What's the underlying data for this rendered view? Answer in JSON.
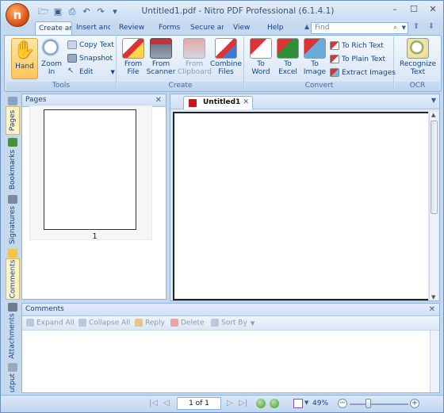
{
  "window": {
    "title": "Untitled1.pdf - Nitro PDF Professional (6.1.4.1)",
    "orb_letter": "n"
  },
  "tabs": [
    "Create and",
    "Insert and",
    "Review",
    "Forms",
    "Secure and",
    "View",
    "Help"
  ],
  "find": {
    "placeholder": "Find"
  },
  "ribbon": {
    "tools": {
      "label": "Tools",
      "hand": "Hand",
      "zoom_in": "Zoom\nIn",
      "copy_text": "Copy Text",
      "snapshot": "Snapshot",
      "edit": "Edit"
    },
    "create": {
      "label": "Create",
      "from_file": "From\nFile",
      "from_scanner": "From\nScanner",
      "from_clipboard": "From\nClipboard",
      "combine_files": "Combine\nFiles"
    },
    "convert": {
      "label": "Convert",
      "to_word": "To\nWord",
      "to_excel": "To\nExcel",
      "to_image": "To\nImage",
      "to_rich_text": "To Rich Text",
      "to_plain_text": "To Plain Text",
      "extract_images": "Extract Images"
    },
    "ocr": {
      "label": "OCR",
      "recognize_text": "Recognize\nText"
    }
  },
  "side_tabs": [
    "Pages",
    "Bookmarks",
    "Signatures",
    "Comments",
    "Attachments",
    "utput"
  ],
  "pages_panel": {
    "title": "Pages",
    "page_number": "1"
  },
  "document": {
    "tab_title": "Untitled1"
  },
  "comments_panel": {
    "title": "Comments",
    "toolbar": [
      "Expand All",
      "Collapse All",
      "Reply",
      "Delete",
      "Sort By"
    ]
  },
  "status": {
    "page_indicator": "1 of 1",
    "zoom_level": "49%"
  },
  "colors": {
    "accent": "#15428b",
    "ribbon_bg": "#dde9f7",
    "selected_button": "#ffc55c",
    "orb": "#e0561a"
  }
}
